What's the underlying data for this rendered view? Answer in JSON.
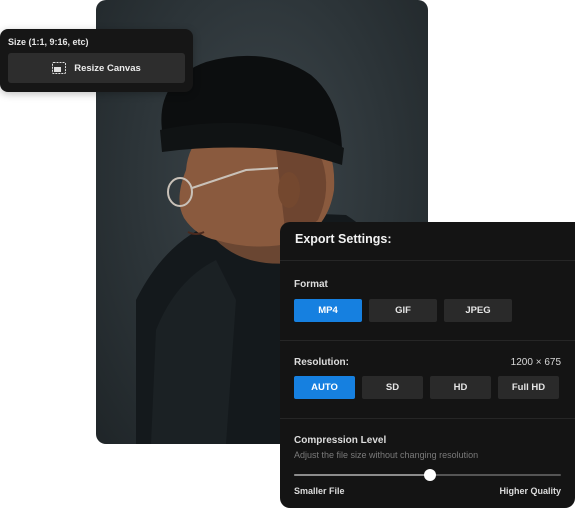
{
  "resize_panel": {
    "label": "Size (1:1, 9:16, etc)",
    "button_label": "Resize Canvas",
    "button_icon": "resize-canvas-icon"
  },
  "export": {
    "title": "Export Settings:",
    "format": {
      "label": "Format",
      "options": [
        "MP4",
        "GIF",
        "JPEG"
      ],
      "selected": "MP4"
    },
    "resolution": {
      "label": "Resolution:",
      "value": "1200 × 675",
      "options": [
        "AUTO",
        "SD",
        "HD",
        "Full HD"
      ],
      "selected": "AUTO"
    },
    "compression": {
      "label": "Compression Level",
      "description": "Adjust the file size without changing resolution",
      "min_label": "Smaller File",
      "max_label": "Higher Quality",
      "level": 0.51
    }
  },
  "colors": {
    "accent": "#1680e0",
    "panel_bg": "#141414",
    "button_bg": "#2a2a2a"
  }
}
